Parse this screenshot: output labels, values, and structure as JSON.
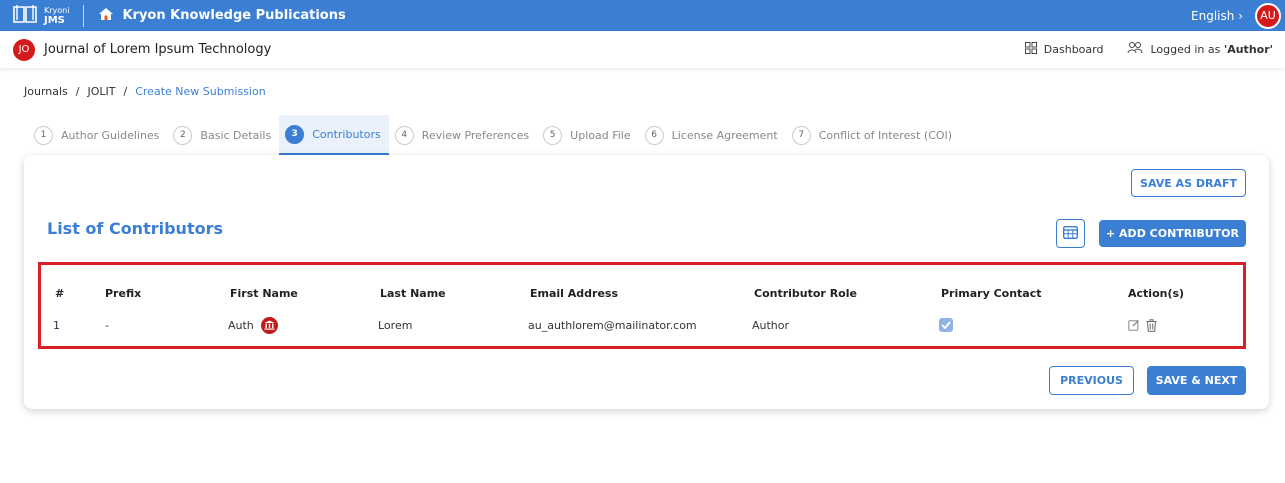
{
  "topbar": {
    "logo_small": "Kryoni",
    "logo_big": "JMS",
    "org_name": "Kryon Knowledge Publications",
    "language": "English",
    "user_initials": "AU",
    "accent": "#3b7fd4",
    "avatar_color": "#d41a1a"
  },
  "subbar": {
    "journal_initials": "JO",
    "journal_title": "Journal of Lorem Ipsum Technology",
    "dashboard_label": "Dashboard",
    "logged_in_prefix": "Logged in as ",
    "logged_in_role": "'Author'"
  },
  "breadcrumb": {
    "items": [
      "Journals",
      "JOLIT"
    ],
    "current": "Create New Submission"
  },
  "tabs": [
    {
      "num": "1",
      "label": "Author Guidelines",
      "active": false
    },
    {
      "num": "2",
      "label": "Basic Details",
      "active": false
    },
    {
      "num": "3",
      "label": "Contributors",
      "active": true
    },
    {
      "num": "4",
      "label": "Review Preferences",
      "active": false
    },
    {
      "num": "5",
      "label": "Upload File",
      "active": false
    },
    {
      "num": "6",
      "label": "License Agreement",
      "active": false
    },
    {
      "num": "7",
      "label": "Conflict of Interest (COI)",
      "active": false
    }
  ],
  "card": {
    "save_draft": "SAVE AS DRAFT",
    "list_title": "List of Contributors",
    "add_contributor": "+ ADD CONTRIBUTOR",
    "previous": "PREVIOUS",
    "save_next": "SAVE & NEXT"
  },
  "table": {
    "headers": [
      "#",
      "Prefix",
      "First Name",
      "Last Name",
      "Email Address",
      "Contributor Role",
      "Primary Contact",
      "Action(s)"
    ],
    "rows": [
      {
        "num": "1",
        "prefix": "-",
        "first_name": "Auth",
        "last_name": "Lorem",
        "email": "au_authlorem@mailinator.com",
        "role": "Author",
        "primary_contact": true
      }
    ]
  },
  "icons": {
    "logo": "book-icon",
    "org": "home-icon",
    "dashboard": "grid-icon",
    "user": "users-icon",
    "table_view": "table-icon",
    "institution": "institution-icon",
    "edit": "edit-icon",
    "delete": "trash-icon"
  }
}
